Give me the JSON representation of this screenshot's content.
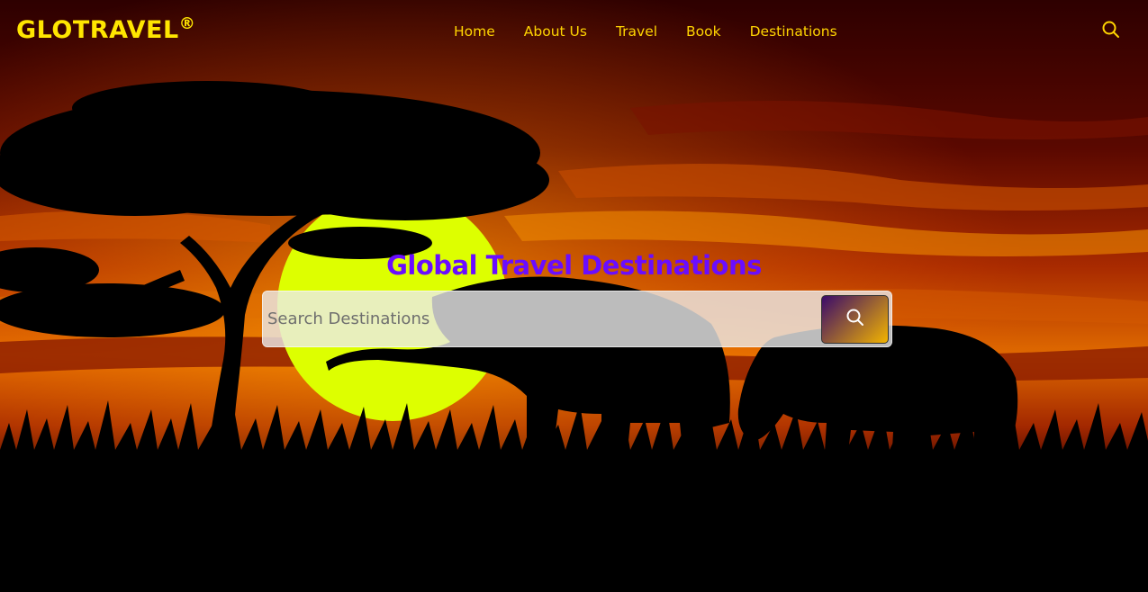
{
  "brand": {
    "name": "GLOTRAVEL",
    "mark": "®",
    "color": "#ffe600"
  },
  "nav": {
    "color": "#ffd400",
    "items": [
      {
        "label": "Home"
      },
      {
        "label": "About Us"
      },
      {
        "label": "Travel"
      },
      {
        "label": "Book"
      },
      {
        "label": "Destinations"
      }
    ],
    "search_icon": "search-icon"
  },
  "hero": {
    "headline": "Global Travel Destinations",
    "headline_color": "#6a0dff",
    "search": {
      "placeholder": "Search Destinations",
      "value": "",
      "button_icon": "search-icon"
    }
  },
  "colors": {
    "sky_top": "#3a0000",
    "sky_mid": "#8b1a00",
    "sky_glow": "#e67300",
    "sun": "#ddff00",
    "button_gradient_start": "#3a0a6b",
    "button_gradient_end": "#f2b400"
  }
}
